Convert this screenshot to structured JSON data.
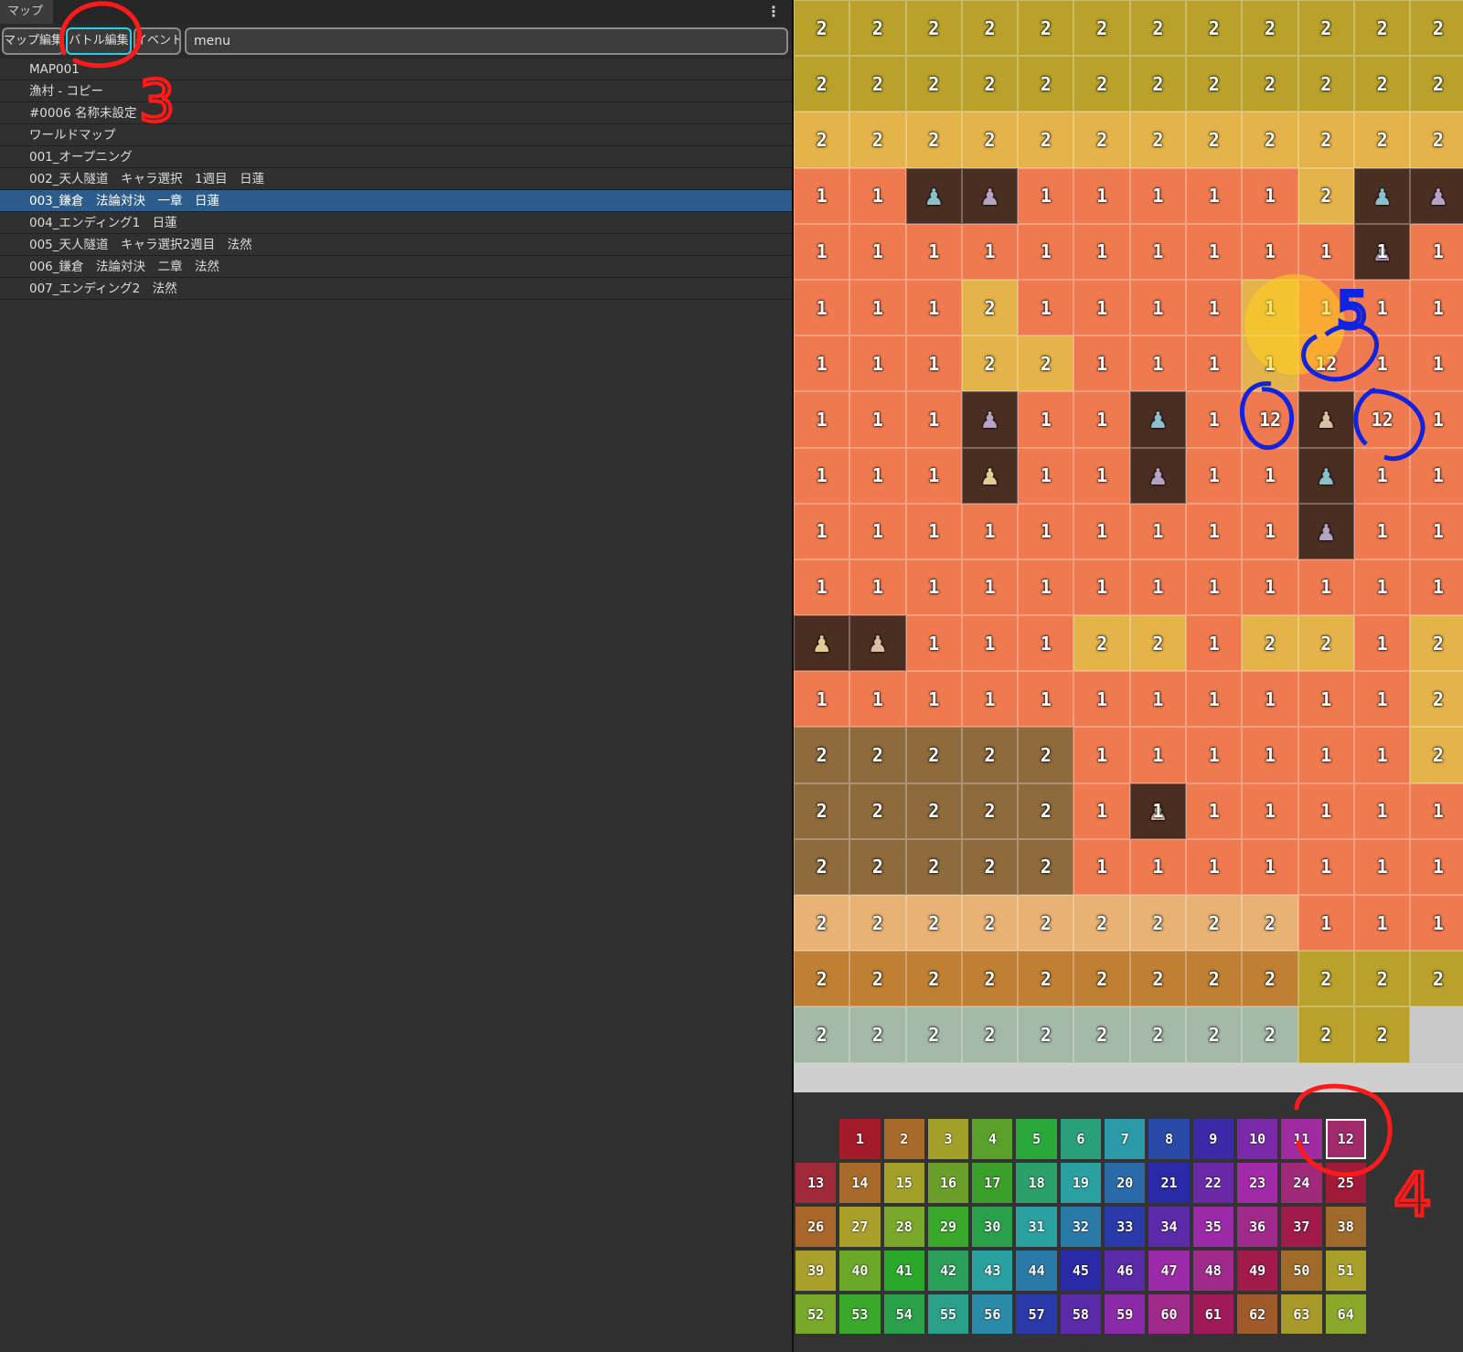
{
  "window": {
    "tab_label": "マップ",
    "menu_icon": "⋮"
  },
  "tabs": [
    {
      "label": "マップ編集"
    },
    {
      "label": "バトル編集",
      "active": true
    },
    {
      "label": "イベント"
    }
  ],
  "search": {
    "value": "menu"
  },
  "map_list": [
    "MAP001",
    "漁村 - コピー",
    "#0006 名称未設定",
    "ワールドマップ",
    "001_オープニング",
    "002_天人隧道　キャラ選択　1週目　日蓮",
    "003_鎌倉　法論対決　一章　日蓮",
    "004_エンディング1　日蓮",
    "005_天人隧道　キャラ選択2週目　法然",
    "006_鎌倉　法論対決　二章　法然",
    "007_エンディング2　法然"
  ],
  "selected_index": 6,
  "annotations": {
    "red_3": "3",
    "red_4": "4",
    "blue_5": "5",
    "annotation_color_red": "#ff1a1a",
    "annotation_color_blue": "#1024e0"
  },
  "map_grid": {
    "rows": [
      [
        "2",
        "2",
        "2",
        "2",
        "2",
        "2",
        "2",
        "2",
        "2",
        "2",
        "2",
        "2"
      ],
      [
        "2",
        "2",
        "2",
        "2",
        "2",
        "2",
        "2",
        "2",
        "2",
        "2",
        "2",
        "2"
      ],
      [
        "2",
        "2",
        "2",
        "2",
        "2",
        "2",
        "2",
        "2",
        "2",
        "2",
        "2",
        "2"
      ],
      [
        "1",
        "1",
        "",
        "",
        "1",
        "1",
        "1",
        "1",
        "1",
        "2",
        "",
        ""
      ],
      [
        "1",
        "1",
        "1",
        "1",
        "1",
        "1",
        "1",
        "1",
        "1",
        "1",
        "1",
        "1"
      ],
      [
        "1",
        "1",
        "1",
        "2",
        "1",
        "1",
        "1",
        "1",
        "1",
        "1",
        "1",
        "1"
      ],
      [
        "1",
        "1",
        "1",
        "2",
        "2",
        "1",
        "1",
        "1",
        "1",
        "12",
        "1",
        "1"
      ],
      [
        "1",
        "1",
        "1",
        "",
        "1",
        "1",
        "",
        "1",
        "12",
        "",
        "12",
        "1"
      ],
      [
        "1",
        "1",
        "1",
        "",
        "1",
        "1",
        "",
        "1",
        "1",
        "",
        "1",
        "1"
      ],
      [
        "1",
        "1",
        "1",
        "1",
        "1",
        "1",
        "1",
        "1",
        "1",
        "",
        "1",
        "1"
      ],
      [
        "1",
        "1",
        "1",
        "1",
        "1",
        "1",
        "1",
        "1",
        "1",
        "1",
        "1",
        "1"
      ],
      [
        "",
        "",
        "1",
        "1",
        "1",
        "2",
        "2",
        "1",
        "2",
        "2",
        "1",
        "2"
      ],
      [
        "1",
        "1",
        "1",
        "1",
        "1",
        "1",
        "1",
        "1",
        "1",
        "1",
        "1",
        "2"
      ],
      [
        "2",
        "2",
        "2",
        "2",
        "2",
        "1",
        "1",
        "1",
        "1",
        "1",
        "1",
        "2"
      ],
      [
        "2",
        "2",
        "2",
        "2",
        "2",
        "1",
        "1",
        "1",
        "1",
        "1",
        "1",
        "1"
      ],
      [
        "2",
        "2",
        "2",
        "2",
        "2",
        "1",
        "1",
        "1",
        "1",
        "1",
        "1",
        "1"
      ],
      [
        "2",
        "2",
        "2",
        "2",
        "2",
        "2",
        "2",
        "2",
        "2",
        "1",
        "1",
        "1"
      ],
      [
        "2",
        "2",
        "2",
        "2",
        "2",
        "2",
        "2",
        "2",
        "2",
        "2",
        "2",
        "2"
      ],
      [
        "2",
        "2",
        "2",
        "2",
        "2",
        "2",
        "2",
        "2",
        "2",
        "2",
        "2",
        ""
      ]
    ],
    "types": [
      [
        "tree",
        "tree",
        "tree",
        "tree",
        "tree",
        "tree",
        "tree",
        "tree",
        "tree",
        "tree",
        "tree",
        "tree"
      ],
      [
        "tree",
        "tree",
        "tree",
        "tree",
        "tree",
        "tree",
        "tree",
        "tree",
        "tree",
        "tree",
        "tree",
        "tree"
      ],
      [
        "t2",
        "t2",
        "t2",
        "t2",
        "t2",
        "t2",
        "t2",
        "t2",
        "t2",
        "t2",
        "t2",
        "t2"
      ],
      [
        "t1",
        "t1",
        "unit",
        "unit",
        "t1",
        "t1",
        "t1",
        "t1",
        "t1",
        "t2",
        "unit",
        "unit"
      ],
      [
        "t1",
        "t1",
        "t1",
        "t1",
        "t1",
        "t1",
        "t1",
        "t1",
        "t1",
        "t1",
        "unit",
        "t1"
      ],
      [
        "t1",
        "t1",
        "t1",
        "t2",
        "t1",
        "t1",
        "t1",
        "t1",
        "t2",
        "t1",
        "t1",
        "t1"
      ],
      [
        "t1",
        "t1",
        "t1",
        "t2",
        "t2",
        "t1",
        "t1",
        "t1",
        "t2",
        "t1",
        "t1",
        "t1"
      ],
      [
        "t1",
        "t1",
        "t1",
        "unit",
        "t1",
        "t1",
        "unit",
        "t1",
        "t1",
        "unit",
        "t1",
        "t1"
      ],
      [
        "t1",
        "t1",
        "t1",
        "unit",
        "t1",
        "t1",
        "unit",
        "t1",
        "t1",
        "unit",
        "t1",
        "t1"
      ],
      [
        "t1",
        "t1",
        "t1",
        "t1",
        "t1",
        "t1",
        "t1",
        "t1",
        "t1",
        "unit",
        "t1",
        "t1"
      ],
      [
        "t1",
        "t1",
        "t1",
        "t1",
        "t1",
        "t1",
        "t1",
        "t1",
        "t1",
        "t1",
        "t1",
        "t1"
      ],
      [
        "unit",
        "unit",
        "t1",
        "t1",
        "t1",
        "t2",
        "t2",
        "t1",
        "t2",
        "t2",
        "t1",
        "t2"
      ],
      [
        "t1",
        "t1",
        "t1",
        "t1",
        "t1",
        "t1",
        "t1",
        "t1",
        "t1",
        "t1",
        "t1",
        "t2"
      ],
      [
        "roof",
        "roof",
        "roof",
        "roof",
        "roof",
        "t1",
        "t1",
        "t1",
        "t1",
        "t1",
        "t1",
        "t2"
      ],
      [
        "roof",
        "roof",
        "roof",
        "roof",
        "roof",
        "t1",
        "unit",
        "t1",
        "t1",
        "t1",
        "t1",
        "t1"
      ],
      [
        "roof",
        "roof",
        "roof",
        "roof",
        "roof",
        "t1",
        "t1",
        "t1",
        "t1",
        "t1",
        "t1",
        "t1"
      ],
      [
        "wall",
        "wall",
        "wall",
        "wall",
        "wall",
        "wall",
        "wall",
        "wall",
        "wall",
        "t1",
        "t1",
        "t1"
      ],
      [
        "wood",
        "wood",
        "wood",
        "wood",
        "wood",
        "wood",
        "wood",
        "wood",
        "wood",
        "tree",
        "tree",
        "tree"
      ],
      [
        "water",
        "water",
        "water",
        "water",
        "water",
        "water",
        "water",
        "water",
        "water",
        "tree",
        "tree",
        "blank"
      ]
    ],
    "unit_glyph": "♟",
    "highlight_color": "#ffd11a"
  },
  "palette": {
    "labels": [
      [
        "",
        "1",
        "2",
        "3",
        "4",
        "5",
        "6",
        "7",
        "8",
        "9",
        "10",
        "11",
        "12"
      ],
      [
        "13",
        "14",
        "15",
        "16",
        "17",
        "18",
        "19",
        "20",
        "21",
        "22",
        "23",
        "24",
        "25"
      ],
      [
        "26",
        "27",
        "28",
        "29",
        "30",
        "31",
        "32",
        "33",
        "34",
        "35",
        "36",
        "37",
        "38"
      ],
      [
        "39",
        "40",
        "41",
        "42",
        "43",
        "44",
        "45",
        "46",
        "47",
        "48",
        "49",
        "50",
        "51"
      ],
      [
        "52",
        "53",
        "54",
        "55",
        "56",
        "57",
        "58",
        "59",
        "60",
        "61",
        "62",
        "63",
        "64"
      ]
    ],
    "colors": [
      [
        "",
        "#a31a2a",
        "#a86a2a",
        "#a3a02a",
        "#5aa02a",
        "#2aa83a",
        "#2aa07a",
        "#2a9aa8",
        "#2a4aa8",
        "#3a2aa8",
        "#7a2aa8",
        "#a02aa0",
        "#a02a6a"
      ],
      [
        "#a02a3a",
        "#a86a2a",
        "#a3a02a",
        "#6aa02a",
        "#3aa02a",
        "#2aa06a",
        "#2aa0a0",
        "#2a6aa8",
        "#2a2aa8",
        "#6a2aa8",
        "#a02aa8",
        "#a02a7a",
        "#a01a3a"
      ],
      [
        "#a8662a",
        "#a8a02a",
        "#7aa82a",
        "#3aa82a",
        "#2aa04a",
        "#2aa0a0",
        "#2a7aa8",
        "#2a3aa8",
        "#5a2aa8",
        "#9a2aa8",
        "#a02a8a",
        "#a01a4a",
        "#a06a2a"
      ],
      [
        "#a8a02a",
        "#6aa82a",
        "#2aa82a",
        "#2aa05a",
        "#2aa0a0",
        "#2a7aa8",
        "#2a2aa8",
        "#5a2aa8",
        "#9a2aa8",
        "#a02a8a",
        "#a01a4a",
        "#a06a2a",
        "#a8a02a"
      ],
      [
        "#7aa82a",
        "#3aa82a",
        "#2aa04a",
        "#2aa08a",
        "#2a8aa8",
        "#2a3aa8",
        "#5a2aa8",
        "#8a2aa8",
        "#a02a8a",
        "#a01a5a",
        "#a05a2a",
        "#a89a2a",
        "#8aa82a"
      ]
    ],
    "selected": "12"
  }
}
